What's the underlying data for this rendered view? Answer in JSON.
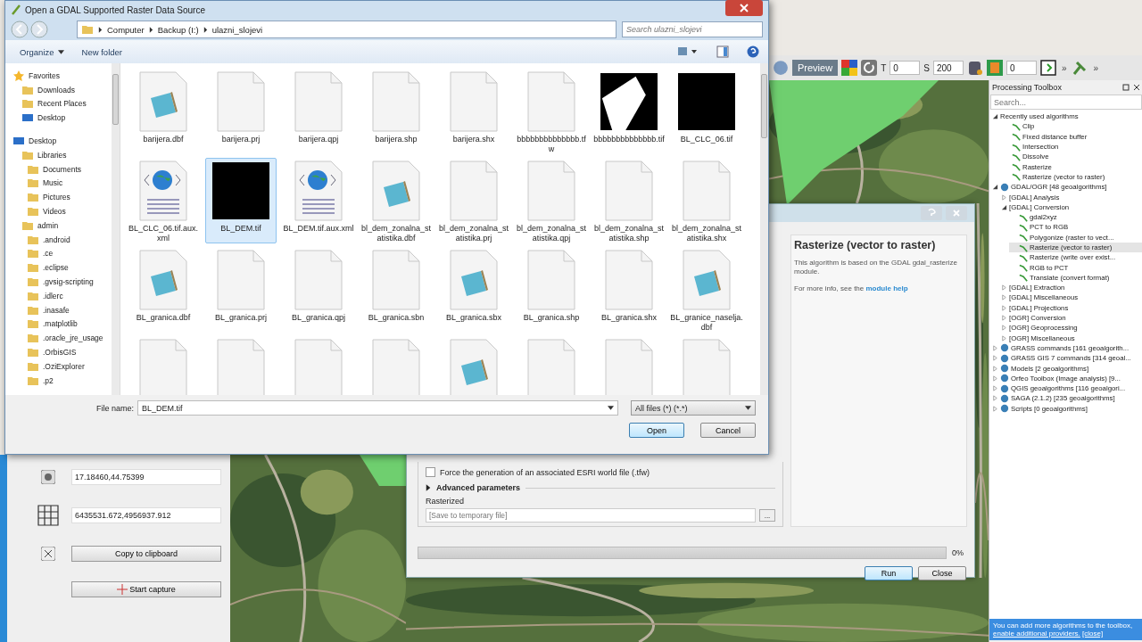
{
  "qgis": {
    "toolbar": {
      "preview": "Preview",
      "t_label": "T",
      "t_value": "0",
      "s_label": "S",
      "s_value": "200",
      "frame_value": "0",
      "more": "»"
    },
    "coordinate_panel": {
      "geographic": "17.18460,44.75399",
      "projected": "6435531.672,4956937.912",
      "copy_button": "Copy to clipboard",
      "capture_button": "Start capture"
    },
    "processing_toolbox": {
      "title": "Processing Toolbox",
      "search": {
        "placeholder": "Search..."
      },
      "tree": [
        {
          "label": "Recently used algorithms",
          "kind": "group",
          "expanded": true,
          "selected": false,
          "children": [
            {
              "label": "Clip",
              "kind": "algorithm",
              "selected": false
            },
            {
              "label": "Fixed distance buffer",
              "kind": "algorithm",
              "selected": false
            },
            {
              "label": "Intersection",
              "kind": "algorithm",
              "selected": false
            },
            {
              "label": "Dissolve",
              "kind": "algorithm",
              "selected": false
            },
            {
              "label": "Rasterize",
              "kind": "algorithm",
              "selected": false
            },
            {
              "label": "Rasterize (vector to raster)",
              "kind": "algorithm",
              "selected": false
            }
          ]
        },
        {
          "label": "GDAL/OGR [48 geoalgorithms]",
          "kind": "provider",
          "expanded": true,
          "selected": false,
          "children": [
            {
              "label": "[GDAL] Analysis",
              "kind": "group",
              "expanded": false,
              "selected": false
            },
            {
              "label": "[GDAL] Conversion",
              "kind": "group",
              "expanded": true,
              "selected": false,
              "children": [
                {
                  "label": "gdal2xyz",
                  "kind": "algorithm",
                  "selected": false
                },
                {
                  "label": "PCT to RGB",
                  "kind": "algorithm",
                  "selected": false
                },
                {
                  "label": "Polygonize (raster to vect...",
                  "kind": "algorithm",
                  "selected": false
                },
                {
                  "label": "Rasterize (vector to raster)",
                  "kind": "algorithm",
                  "selected": true
                },
                {
                  "label": "Rasterize (write over exist...",
                  "kind": "algorithm",
                  "selected": false
                },
                {
                  "label": "RGB to PCT",
                  "kind": "algorithm",
                  "selected": false
                },
                {
                  "label": "Translate (convert format)",
                  "kind": "algorithm",
                  "selected": false
                }
              ]
            },
            {
              "label": "[GDAL] Extraction",
              "kind": "group",
              "expanded": false,
              "selected": false
            },
            {
              "label": "[GDAL] Miscellaneous",
              "kind": "group",
              "expanded": false,
              "selected": false
            },
            {
              "label": "[GDAL] Projections",
              "kind": "group",
              "expanded": false,
              "selected": false
            },
            {
              "label": "[OGR] Conversion",
              "kind": "group",
              "expanded": false,
              "selected": false
            },
            {
              "label": "[OGR] Geoprocessing",
              "kind": "group",
              "expanded": false,
              "selected": false
            },
            {
              "label": "[OGR] Miscellaneous",
              "kind": "group",
              "expanded": false,
              "selected": false
            }
          ]
        },
        {
          "label": "GRASS commands [161 geoalgorith...",
          "kind": "provider",
          "expanded": false,
          "selected": false
        },
        {
          "label": "GRASS GIS 7 commands [314 geoal...",
          "kind": "provider",
          "expanded": false,
          "selected": false
        },
        {
          "label": "Models [2 geoalgorithms]",
          "kind": "provider",
          "expanded": false,
          "selected": false
        },
        {
          "label": "Orfeo Toolbox (Image analysis) [9...",
          "kind": "provider",
          "expanded": false,
          "selected": false
        },
        {
          "label": "QGIS geoalgorithms [116 geoalgori...",
          "kind": "provider",
          "expanded": false,
          "selected": false
        },
        {
          "label": "SAGA (2.1.2) [235 geoalgorithms]",
          "kind": "provider",
          "expanded": false,
          "selected": false
        },
        {
          "label": "Scripts [0 geoalgorithms]",
          "kind": "provider",
          "expanded": false,
          "selected": false
        }
      ],
      "info_bar": {
        "text": "You can add more algorithms to the toolbox,",
        "link": "enable additional providers.",
        "close": "[close]"
      }
    }
  },
  "rasterize_dialog": {
    "heading": "Rasterize (vector to raster)",
    "description": "This algorithm is based on the GDAL gdal_rasterize module.",
    "more_info": "For more info, see the",
    "link": "module help",
    "world_file": {
      "label": "Force the generation of an associated ESRI world file (.tfw)",
      "checked": false
    },
    "advanced": {
      "label": "Advanced parameters",
      "expanded": false
    },
    "output": {
      "label": "Rasterized",
      "placeholder": "[Save to temporary file]",
      "browse": "..."
    },
    "progress": {
      "level": 0,
      "reading": "0%"
    },
    "buttons": [
      "Run",
      "Close"
    ]
  },
  "file_dialog": {
    "title": "Open a GDAL Supported Raster Data Source",
    "breadcrumbs": [
      "Computer",
      "Backup (I:)",
      "ulazni_slojevi"
    ],
    "search": {
      "placeholder": "Search ulazni_slojevi"
    },
    "toolbar": [
      "Organize",
      "New folder"
    ],
    "navigation": [
      {
        "label": "Favorites",
        "kind": "favorites",
        "children": [
          {
            "label": "Downloads",
            "kind": "folder"
          },
          {
            "label": "Recent Places",
            "kind": "folder"
          },
          {
            "label": "Desktop",
            "kind": "desktop"
          }
        ]
      },
      {
        "label": "Desktop",
        "kind": "desktop",
        "children": [
          {
            "label": "Libraries",
            "kind": "folder",
            "children": [
              {
                "label": "Documents",
                "kind": "folder"
              },
              {
                "label": "Music",
                "kind": "folder"
              },
              {
                "label": "Pictures",
                "kind": "folder"
              },
              {
                "label": "Videos",
                "kind": "folder"
              }
            ]
          },
          {
            "label": "admin",
            "kind": "folder",
            "children": [
              {
                "label": ".android",
                "kind": "folder"
              },
              {
                "label": ".ce",
                "kind": "folder"
              },
              {
                "label": ".eclipse",
                "kind": "folder"
              },
              {
                "label": ".gvsig-scripting",
                "kind": "folder"
              },
              {
                "label": ".idlerc",
                "kind": "folder"
              },
              {
                "label": ".inasafe",
                "kind": "folder"
              },
              {
                "label": ".matplotlib",
                "kind": "folder"
              },
              {
                "label": ".oracle_jre_usage",
                "kind": "folder"
              },
              {
                "label": ".OrbisGIS",
                "kind": "folder"
              },
              {
                "label": ".OziExplorer",
                "kind": "folder"
              },
              {
                "label": ".p2",
                "kind": "folder"
              }
            ]
          }
        ]
      }
    ],
    "files": [
      {
        "name": "barijera.dbf",
        "kind": "notepad",
        "selected": false
      },
      {
        "name": "barijera.prj",
        "kind": "blank",
        "selected": false
      },
      {
        "name": "barijera.qpj",
        "kind": "blank",
        "selected": false
      },
      {
        "name": "barijera.shp",
        "kind": "blank",
        "selected": false
      },
      {
        "name": "barijera.shx",
        "kind": "blank",
        "selected": false
      },
      {
        "name": "bbbbbbbbbbbbbb.tfw",
        "kind": "blank",
        "selected": false
      },
      {
        "name": "bbbbbbbbbbbbbb.tif",
        "kind": "image-shape",
        "selected": false
      },
      {
        "name": "BL_CLC_06.tif",
        "kind": "image-black",
        "selected": false
      },
      {
        "name": "BL_CLC_06.tif.aux.xml",
        "kind": "web",
        "selected": false
      },
      {
        "name": "BL_DEM.tif",
        "kind": "image-black",
        "selected": true
      },
      {
        "name": "BL_DEM.tif.aux.xml",
        "kind": "web",
        "selected": false
      },
      {
        "name": "bl_dem_zonalna_statistika.dbf",
        "kind": "notepad",
        "selected": false
      },
      {
        "name": "bl_dem_zonalna_statistika.prj",
        "kind": "blank",
        "selected": false
      },
      {
        "name": "bl_dem_zonalna_statistika.qpj",
        "kind": "blank",
        "selected": false
      },
      {
        "name": "bl_dem_zonalna_statistika.shp",
        "kind": "blank",
        "selected": false
      },
      {
        "name": "bl_dem_zonalna_statistika.shx",
        "kind": "blank",
        "selected": false
      },
      {
        "name": "BL_granica.dbf",
        "kind": "notepad",
        "selected": false
      },
      {
        "name": "BL_granica.prj",
        "kind": "blank",
        "selected": false
      },
      {
        "name": "BL_granica.qpj",
        "kind": "blank",
        "selected": false
      },
      {
        "name": "BL_granica.sbn",
        "kind": "blank",
        "selected": false
      },
      {
        "name": "BL_granica.sbx",
        "kind": "notepad",
        "selected": false
      },
      {
        "name": "BL_granica.shp",
        "kind": "blank",
        "selected": false
      },
      {
        "name": "BL_granica.shx",
        "kind": "blank",
        "selected": false
      },
      {
        "name": "BL_granice_naselja.dbf",
        "kind": "notepad",
        "selected": false
      },
      {
        "kind": "blank",
        "selected": false
      },
      {
        "kind": "blank",
        "selected": false
      },
      {
        "kind": "blank",
        "selected": false
      },
      {
        "kind": "blank",
        "selected": false
      },
      {
        "kind": "notepad",
        "selected": false
      },
      {
        "kind": "blank",
        "selected": false
      },
      {
        "kind": "blank",
        "selected": false
      },
      {
        "kind": "blank",
        "selected": false
      }
    ],
    "file_name_label": "File name:",
    "file_name": "BL_DEM.tif",
    "filter": "All files (*) (*.*)",
    "buttons": [
      "Open",
      "Cancel"
    ]
  }
}
